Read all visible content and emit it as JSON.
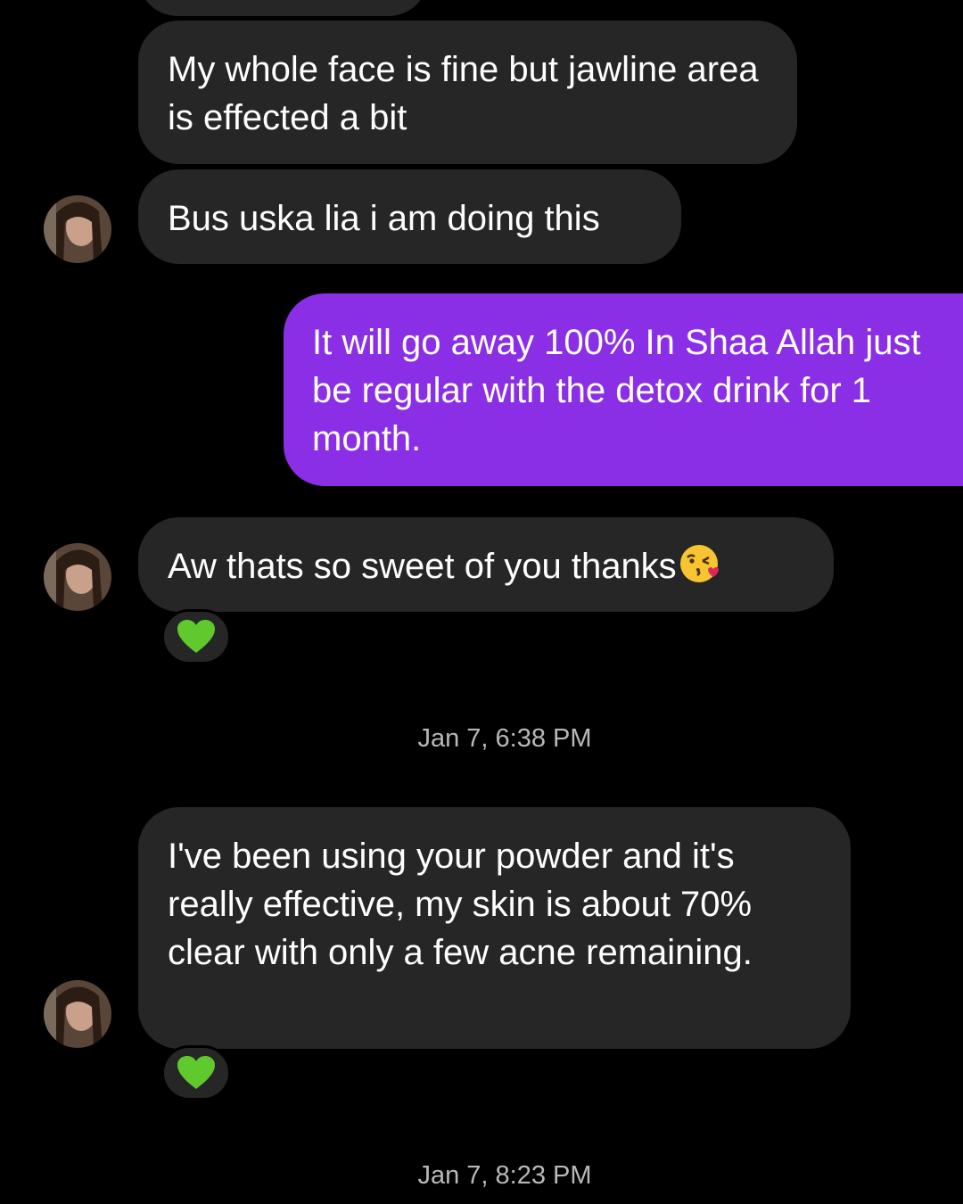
{
  "messages": [
    {
      "sender": "them",
      "text": "My whole face is fine but jawline area is effected a bit"
    },
    {
      "sender": "them",
      "text": "Bus uska lia i am doing this"
    },
    {
      "sender": "me",
      "text": "It will go away 100% In Shaa Allah just be regular with the detox drink for 1 month."
    },
    {
      "sender": "them",
      "text": "Aw thats so sweet of you thanks",
      "emoji": "kissing-face-emoji",
      "reaction": "green-heart-icon"
    },
    {
      "sender": "them",
      "text": "I've been using your powder and it's really effective, my skin is about 70% clear with only a few acne remaining.",
      "reaction": "green-heart-icon"
    }
  ],
  "timestamps": [
    "Jan 7, 6:38 PM",
    "Jan 7, 8:23 PM"
  ],
  "colors": {
    "background": "#000000",
    "incoming_bubble": "#262626",
    "outgoing_bubble": "#8a2fe6",
    "text": "#ffffff",
    "timestamp": "#b8b8b8",
    "reaction_heart": "#5fc92e"
  }
}
